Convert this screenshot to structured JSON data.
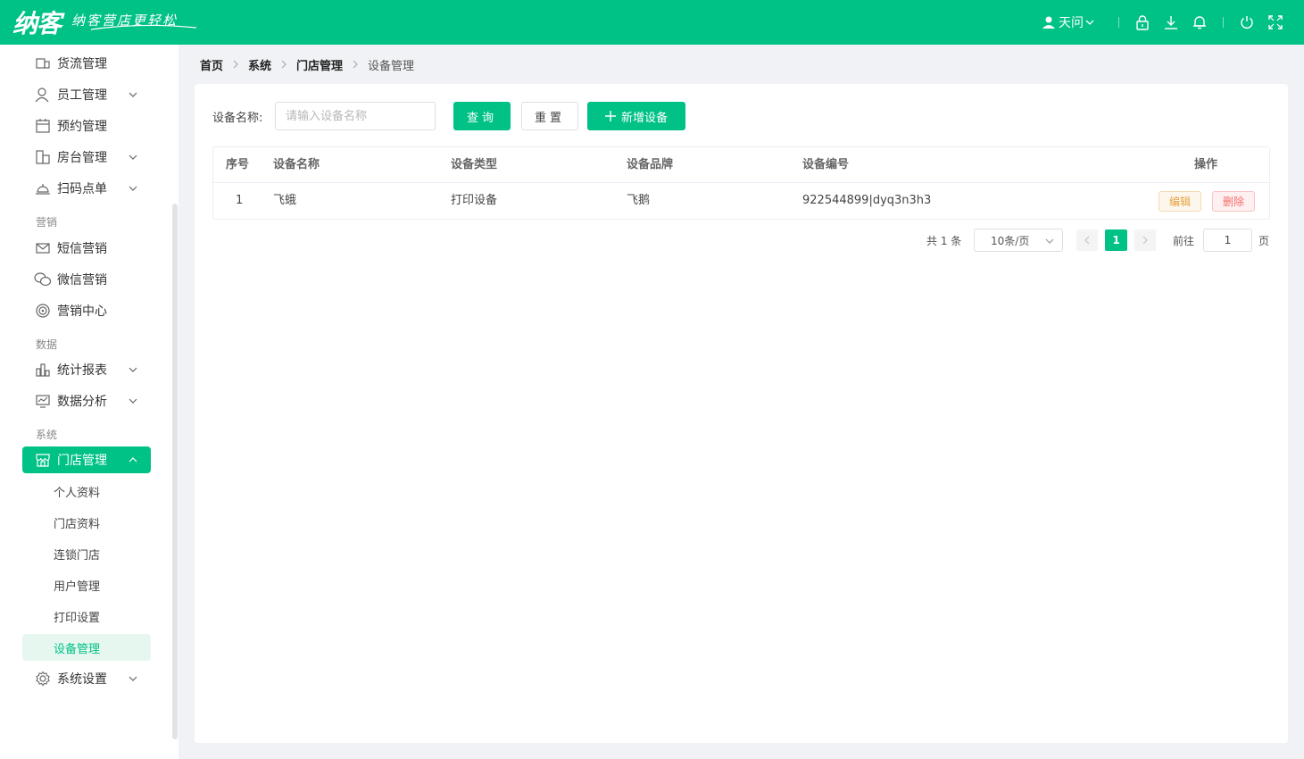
{
  "header": {
    "logo_text": "纳客",
    "slogan": "纳客营店更轻松",
    "user_name": "天问",
    "brand_color": "#00c186"
  },
  "sidebar": {
    "items": [
      {
        "label": "货流管理",
        "icon": "stock-icon"
      },
      {
        "label": "员工管理",
        "icon": "user-icon",
        "has_arrow": true
      },
      {
        "label": "预约管理",
        "icon": "calendar-icon"
      },
      {
        "label": "房台管理",
        "icon": "room-icon",
        "has_arrow": true
      },
      {
        "label": "扫码点单",
        "icon": "bell-service-icon",
        "has_arrow": true
      }
    ],
    "group_marketing": "营销",
    "marketing_items": [
      {
        "label": "短信营销",
        "icon": "mail-icon"
      },
      {
        "label": "微信营销",
        "icon": "wechat-icon"
      },
      {
        "label": "营销中心",
        "icon": "target-icon"
      }
    ],
    "group_data": "数据",
    "data_items": [
      {
        "label": "统计报表",
        "icon": "bar-chart-icon",
        "has_arrow": true
      },
      {
        "label": "数据分析",
        "icon": "monitor-chart-icon",
        "has_arrow": true
      }
    ],
    "group_system": "系统",
    "store_manage": {
      "label": "门店管理",
      "icon": "store-icon"
    },
    "store_sub": [
      "个人资料",
      "门店资料",
      "连锁门店",
      "用户管理",
      "打印设置",
      "设备管理"
    ],
    "system_settings": {
      "label": "系统设置",
      "icon": "gear-icon"
    }
  },
  "breadcrumb": [
    "首页",
    "系统",
    "门店管理",
    "设备管理"
  ],
  "search": {
    "label": "设备名称:",
    "placeholder": "请输入设备名称",
    "query_label": "查询",
    "reset_label": "重置",
    "add_label": "新增设备"
  },
  "table": {
    "headers": [
      "序号",
      "设备名称",
      "设备类型",
      "设备品牌",
      "设备编号",
      "操作"
    ],
    "rows": [
      {
        "idx": "1",
        "name": "飞蛾",
        "type": "打印设备",
        "brand": "飞鹅",
        "code": "922544899|dyq3n3h3",
        "edit": "编辑",
        "delete": "删除"
      }
    ]
  },
  "pagination": {
    "total": "共 1 条",
    "page_size": "10条/页",
    "current": "1",
    "goto_label": "前往",
    "goto_value": "1",
    "page_suffix": "页"
  }
}
